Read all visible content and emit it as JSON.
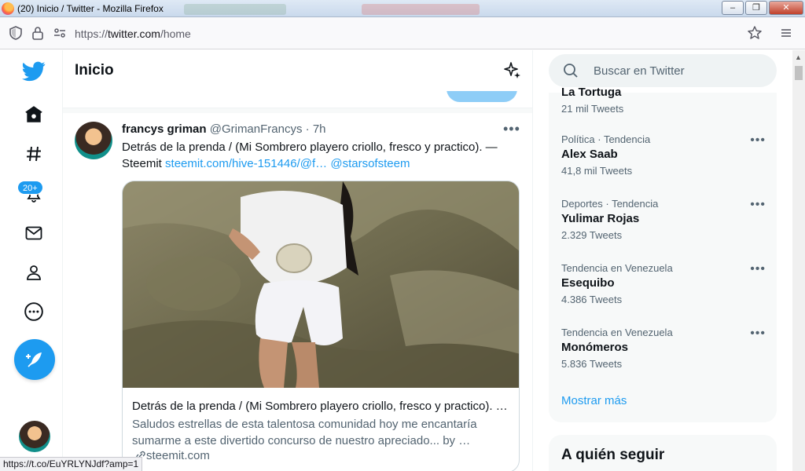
{
  "window": {
    "title": "(20) Inicio / Twitter - Mozilla Firefox",
    "minimize": "–",
    "maximize": "❐",
    "close": "✕"
  },
  "browser": {
    "url_scheme": "https://",
    "url_host": "twitter.com",
    "url_path": "/home"
  },
  "nav": {
    "notifications_badge": "20+"
  },
  "header": {
    "title": "Inicio"
  },
  "tweet": {
    "name": "francys griman",
    "handle": "@GrimanFrancys",
    "sep": " · ",
    "time": "7h",
    "more": "•••",
    "text": "Detrás de la prenda / (Mi Sombrero playero criollo, fresco y practico). — Steemit ",
    "link": "steemit.com/hive-151446/@f…",
    "mention": "@starsofsteem",
    "card": {
      "title": "Detrás de la prenda / (Mi Sombrero playero criollo, fresco y practico). …",
      "description": "Saludos estrellas de esta talentosa comunidad hoy me encantaría sumarme a este divertido concurso de nuestro apreciado... by …",
      "domain": "steemit.com"
    }
  },
  "sidebar": {
    "search_placeholder": "Buscar en Twitter",
    "partial_trend": {
      "name": "La Tortuga",
      "count": "21 mil Tweets"
    },
    "trends": [
      {
        "context": "Política · Tendencia",
        "name": "Alex Saab",
        "count": "41,8 mil Tweets"
      },
      {
        "context": "Deportes · Tendencia",
        "name": "Yulimar Rojas",
        "count": "2.329 Tweets"
      },
      {
        "context": "Tendencia en Venezuela",
        "name": "Esequibo",
        "count": "4.386 Tweets"
      },
      {
        "context": "Tendencia en Venezuela",
        "name": "Monómeros",
        "count": "5.836 Tweets"
      }
    ],
    "trend_more": "•••",
    "show_more": "Mostrar más",
    "who_to_follow": "A quién seguir"
  },
  "status": {
    "link": "https://t.co/EuYRLYNJdf?amp=1"
  },
  "colors": {
    "accent": "#1d9bf0",
    "text_secondary": "#536471"
  }
}
